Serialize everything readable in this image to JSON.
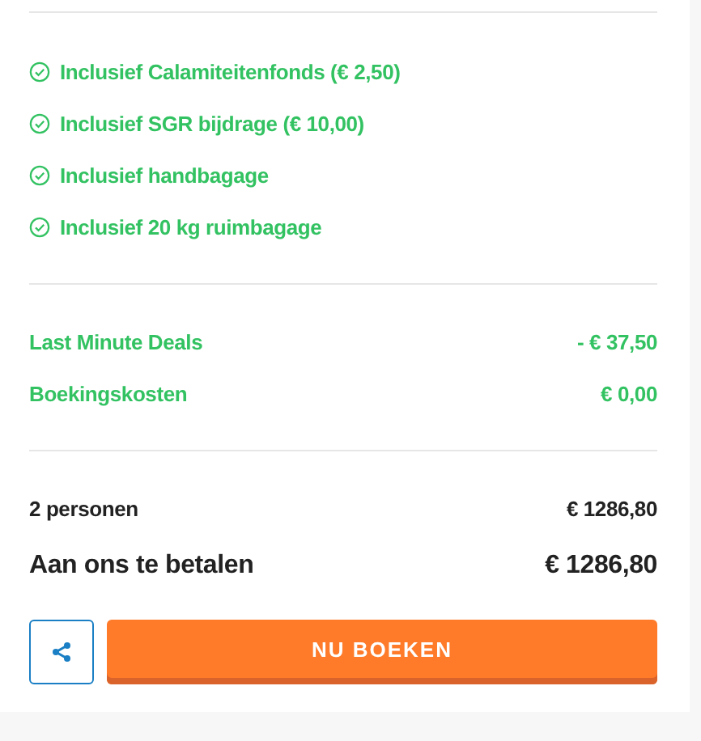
{
  "inclusions": [
    {
      "label": "Inclusief Calamiteitenfonds (€ 2,50)"
    },
    {
      "label": "Inclusief SGR bijdrage (€ 10,00)"
    },
    {
      "label": "Inclusief handbagage"
    },
    {
      "label": "Inclusief 20 kg ruimbagage"
    }
  ],
  "discounts": [
    {
      "label": "Last Minute Deals",
      "amount": "- € 37,50"
    },
    {
      "label": "Boekingskosten",
      "amount": "€ 0,00"
    }
  ],
  "persons": {
    "label": "2 personen",
    "amount": "€ 1286,80"
  },
  "total": {
    "label": "Aan ons te betalen",
    "amount": "€ 1286,80"
  },
  "book_button": "NU BOEKEN"
}
